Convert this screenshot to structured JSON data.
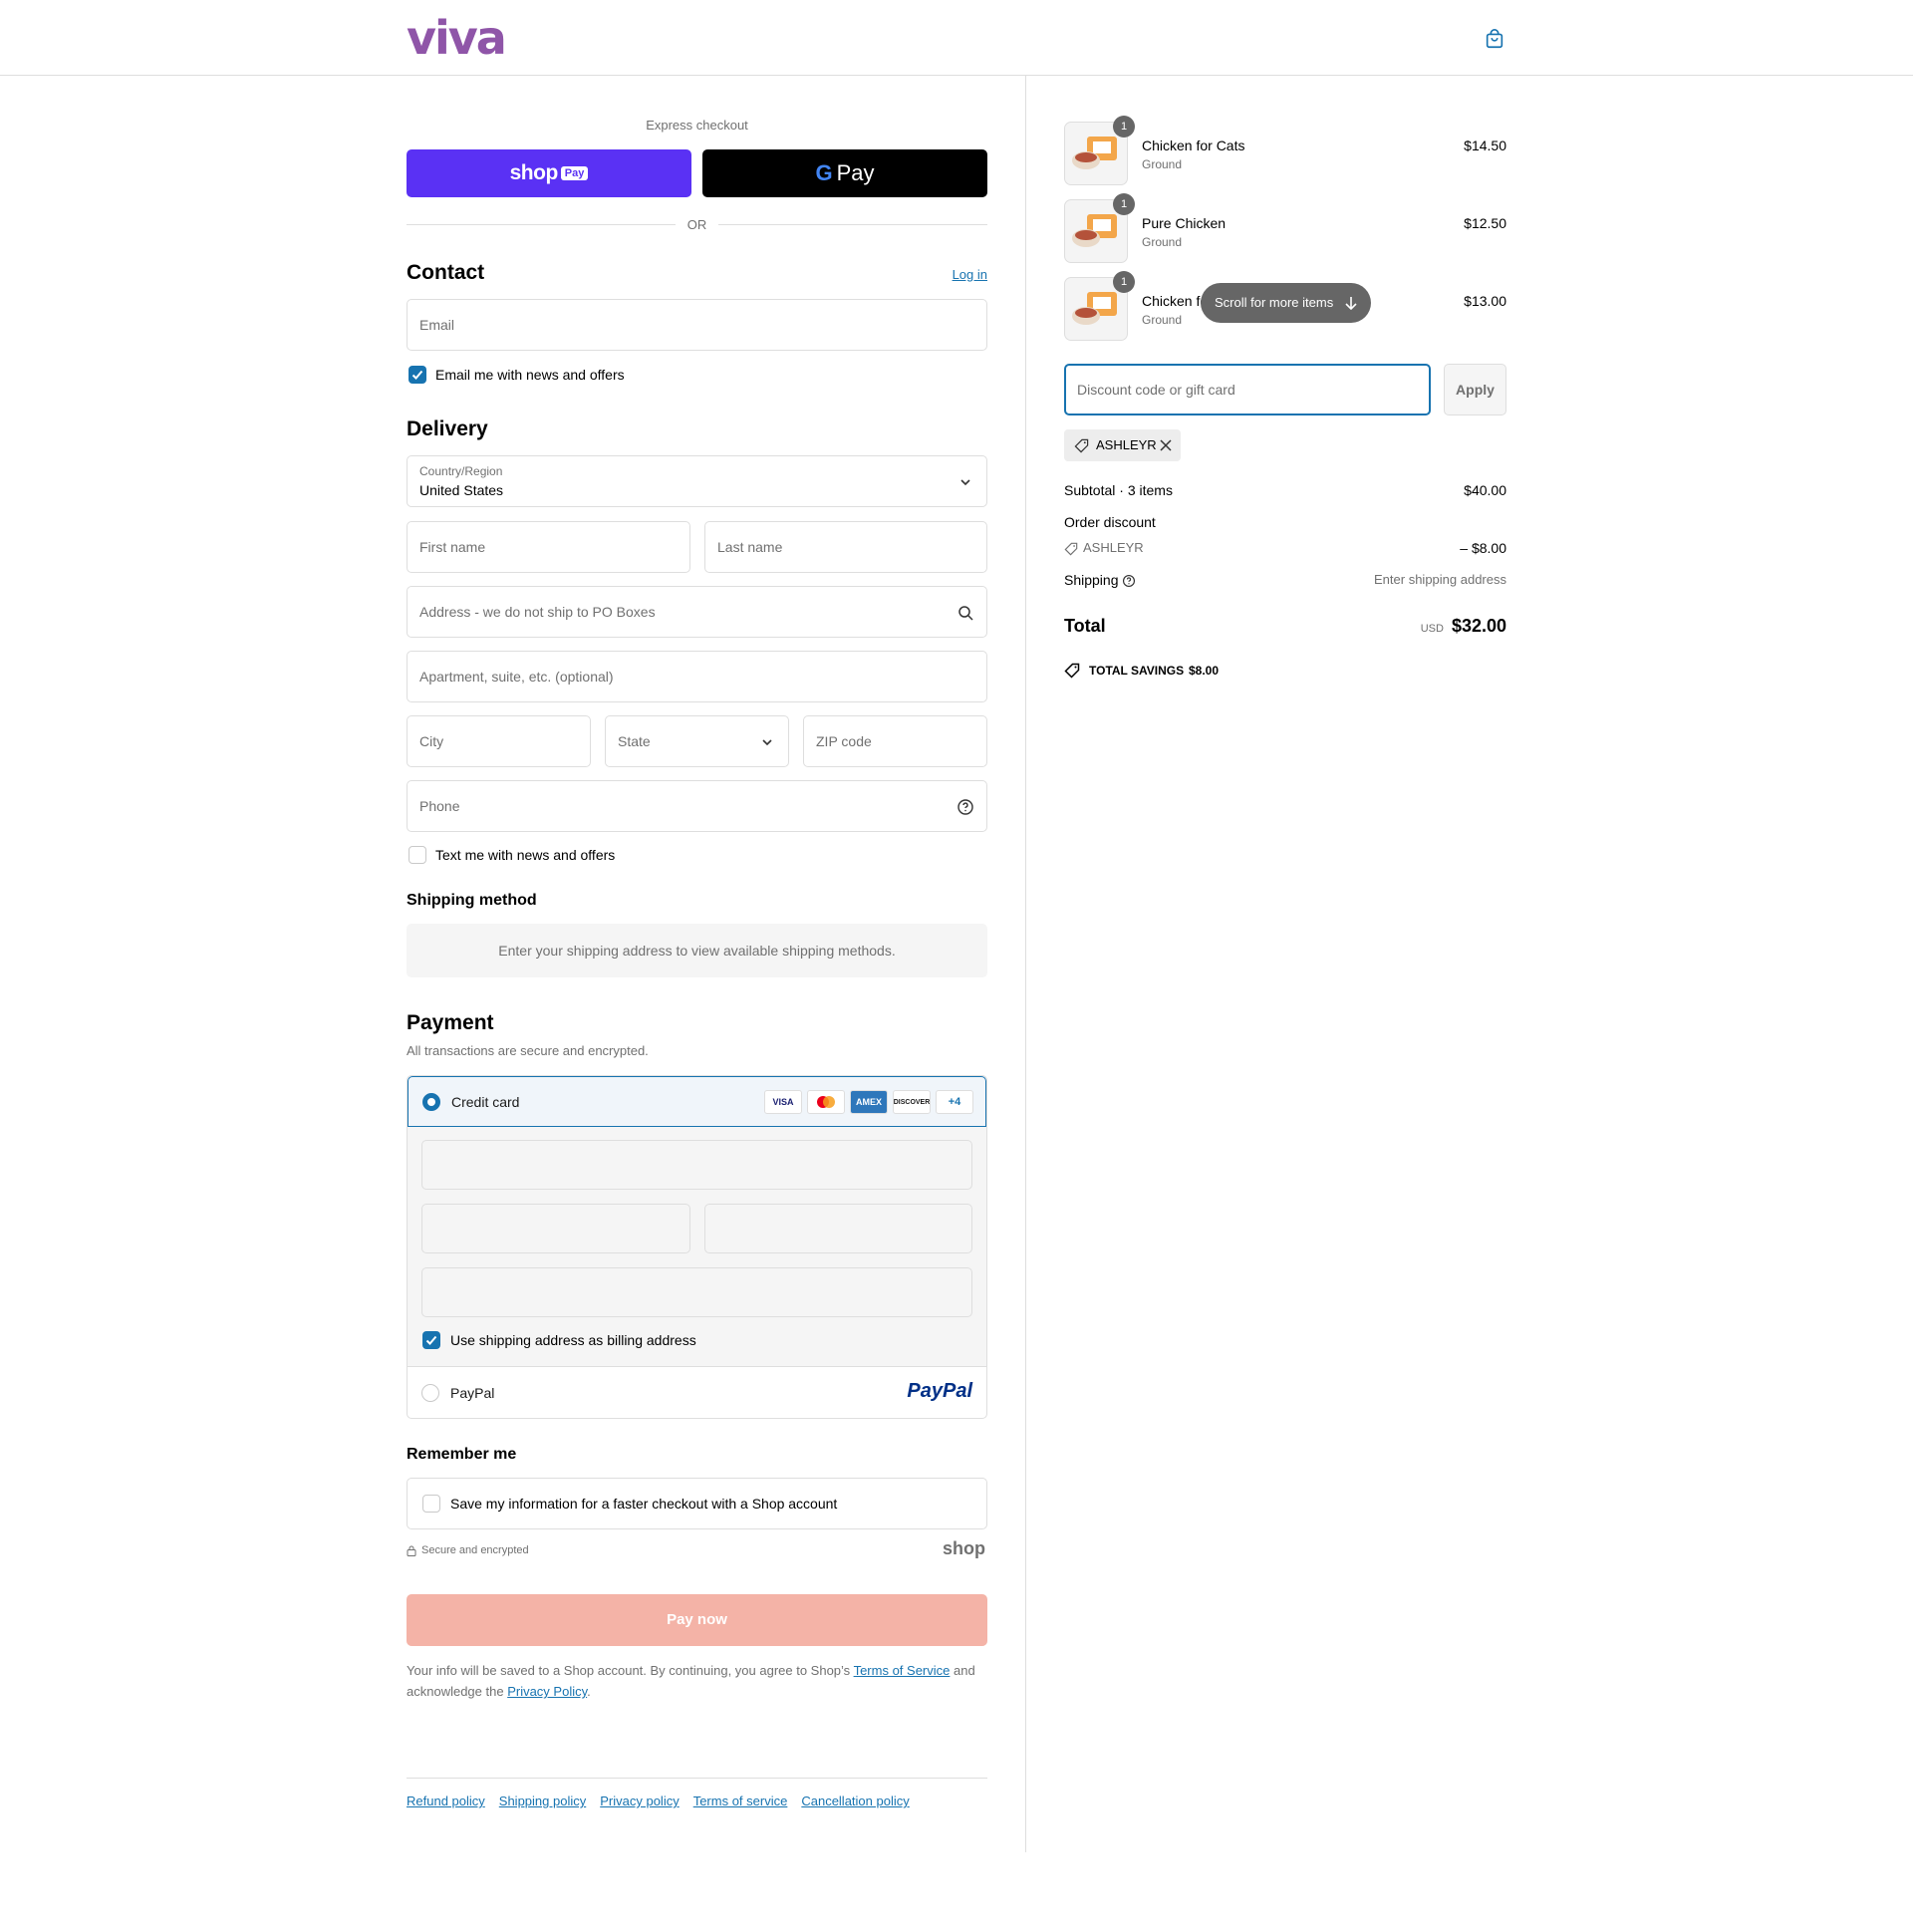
{
  "header": {
    "brand": "viva",
    "cart_icon": "shopping-bag-icon"
  },
  "express": {
    "label": "Express checkout",
    "shop_pay": {
      "shop": "shop",
      "pay": "Pay"
    },
    "gpay": {
      "g": "G",
      "pay": "Pay"
    },
    "or": "OR"
  },
  "contact": {
    "title": "Contact",
    "login": "Log in",
    "email_placeholder": "Email",
    "email_opt_in": "Email me with news and offers",
    "email_opt_in_checked": true
  },
  "delivery": {
    "title": "Delivery",
    "country_label": "Country/Region",
    "country_value": "United States",
    "first_name": "First name",
    "last_name": "Last name",
    "address": "Address - we do not ship to PO Boxes",
    "apartment": "Apartment, suite, etc. (optional)",
    "city": "City",
    "state": "State",
    "zip": "ZIP code",
    "phone": "Phone",
    "sms_opt_in": "Text me with news and offers",
    "sms_opt_in_checked": false
  },
  "shipping_method": {
    "title": "Shipping method",
    "info": "Enter your shipping address to view available shipping methods."
  },
  "payment": {
    "title": "Payment",
    "subtitle": "All transactions are secure and encrypted.",
    "credit_card": "Credit card",
    "card_brands": [
      "VISA",
      "MC",
      "AMEX",
      "DISCOVER"
    ],
    "more_cards": "+4",
    "billing_same": "Use shipping address as billing address",
    "paypal": "PayPal",
    "paypal_logo": "PayPal"
  },
  "remember": {
    "title": "Remember me",
    "save_info": "Save my information for a faster checkout with a Shop account",
    "secure": "Secure and encrypted",
    "shop_logo": "shop"
  },
  "pay_now": "Pay now",
  "legal": {
    "text_before": "Your info will be saved to a Shop account. By continuing, you agree to Shop’s ",
    "terms": "Terms of Service",
    "text_mid": " and acknowledge the ",
    "privacy": "Privacy Policy",
    "text_end": "."
  },
  "footer": {
    "links": [
      "Refund policy",
      "Shipping policy",
      "Privacy policy",
      "Terms of service",
      "Cancellation policy"
    ]
  },
  "cart": {
    "items": [
      {
        "name": "Chicken for Cats",
        "variant": "Ground",
        "price": "$14.50",
        "qty": "1"
      },
      {
        "name": "Pure Chicken",
        "variant": "Ground",
        "price": "$12.50",
        "qty": "1"
      },
      {
        "name": "Chicken fo",
        "variant": "Ground",
        "price": "$13.00",
        "qty": "1"
      }
    ],
    "scroll_hint": "Scroll for more items",
    "discount_placeholder": "Discount code or gift card",
    "apply": "Apply",
    "applied_code": "ASHLEYR",
    "subtotal_label": "Subtotal · 3 items",
    "subtotal_value": "$40.00",
    "order_discount_label": "Order discount",
    "discount_code": "ASHLEYR",
    "discount_value": "– $8.00",
    "shipping_label": "Shipping",
    "shipping_value": "Enter shipping address",
    "total_label": "Total",
    "currency": "USD",
    "total_value": "$32.00",
    "savings_label": "TOTAL SAVINGS",
    "savings_value": "$8.00"
  }
}
